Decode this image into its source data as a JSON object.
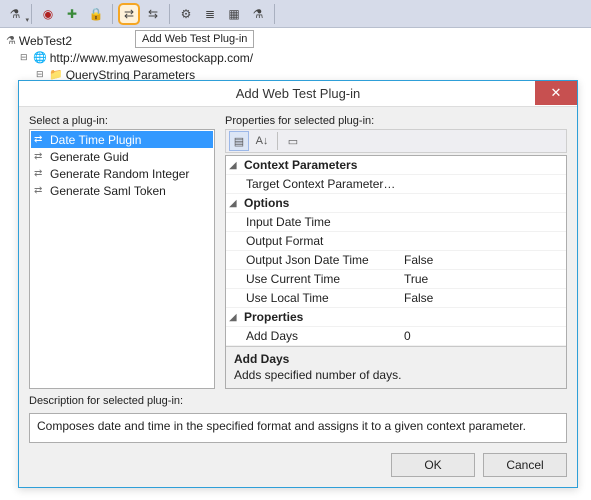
{
  "tooltip": "Add Web Test Plug-in",
  "tree": {
    "root": "WebTest2",
    "url": "http://www.myawesomestockapp.com/",
    "child": "QueryString Parameters"
  },
  "dialog": {
    "title": "Add Web Test Plug-in",
    "select_label": "Select a plug-in:",
    "props_label": "Properties for selected plug-in:",
    "plugins": [
      "Date Time Plugin",
      "Generate Guid",
      "Generate Random Integer",
      "Generate Saml Token"
    ],
    "selected_plugin_index": 0,
    "properties": {
      "cat_context": "Context Parameters",
      "target_context": "Target Context Parameter Nam",
      "cat_options": "Options",
      "rows": [
        {
          "name": "Input Date Time",
          "val": ""
        },
        {
          "name": "Output Format",
          "val": ""
        },
        {
          "name": "Output Json Date Time",
          "val": "False"
        },
        {
          "name": "Use Current Time",
          "val": "True"
        },
        {
          "name": "Use Local Time",
          "val": "False"
        }
      ],
      "cat_props": "Properties",
      "add_days_name": "Add Days",
      "add_days_val": "0"
    },
    "help": {
      "title": "Add Days",
      "text": "Adds specified number of days."
    },
    "desc_label": "Description for selected plug-in:",
    "description": "Composes date and time in the specified format and assigns it to a given context parameter.",
    "ok": "OK",
    "cancel": "Cancel"
  }
}
